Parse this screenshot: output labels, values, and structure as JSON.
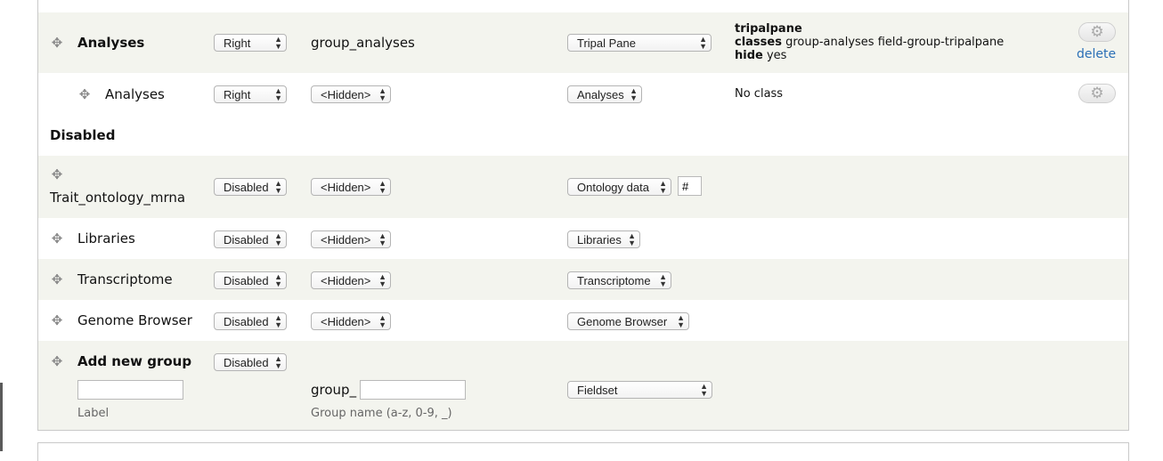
{
  "rows": {
    "analyses_group": {
      "label": "Analyses",
      "region": "Right",
      "machine_name": "group_analyses",
      "format": "Tripal Pane",
      "summary_type": "tripalpane",
      "summary_classes_label": "classes",
      "summary_classes_value": "group-analyses field-group-tripalpane",
      "summary_hide_label": "hide",
      "summary_hide_value": "yes",
      "delete_link": "delete"
    },
    "analyses_field": {
      "label": "Analyses",
      "region": "Right",
      "parent": "<Hidden>",
      "format": "Analyses",
      "summary": "No class"
    },
    "disabled_heading": "Disabled",
    "trait": {
      "label": "Trait_ontology_mrna",
      "region": "Disabled",
      "parent": "<Hidden>",
      "format": "Ontology data",
      "extra_value": "#"
    },
    "libraries": {
      "label": "Libraries",
      "region": "Disabled",
      "parent": "<Hidden>",
      "format": "Libraries"
    },
    "transcriptome": {
      "label": "Transcriptome",
      "region": "Disabled",
      "parent": "<Hidden>",
      "format": "Transcriptome"
    },
    "genome_browser": {
      "label": "Genome Browser",
      "region": "Disabled",
      "parent": "<Hidden>",
      "format": "Genome Browser"
    },
    "add_new_group": {
      "label": "Add new group",
      "region": "Disabled",
      "label_field_value": "",
      "label_description": "Label",
      "group_prefix": "group_",
      "group_name_value": "",
      "group_name_description": "Group name (a-z, 0-9, _)",
      "format": "Fieldset"
    }
  },
  "icons": {
    "drag_handle": "move-cross-icon",
    "settings": "gear-icon",
    "select_arrow": "updown-arrows"
  },
  "colors": {
    "odd_row_bg": "#f3f4ee",
    "link": "#2a6fb6",
    "border": "#c9c9c9"
  }
}
